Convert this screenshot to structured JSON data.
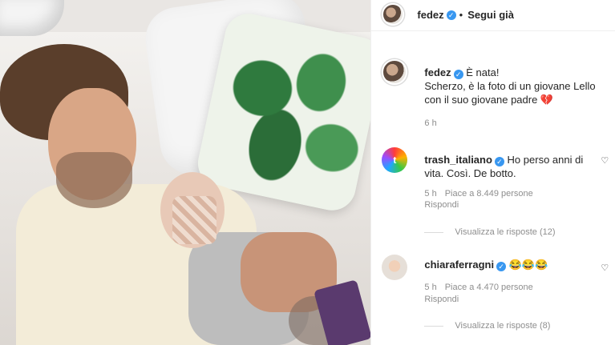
{
  "header": {
    "username": "fedez",
    "separator": "•",
    "follow_label": "Segui già"
  },
  "caption": {
    "username": "fedez",
    "text_line1": "È nata!",
    "text_line2": "Scherzo, è la foto di un giovane Lello",
    "text_line3": "con il suo giovane padre 💔",
    "time": "6 h"
  },
  "comments": [
    {
      "username": "trash_italiano",
      "avatar_letter": "t",
      "text_line1": "Ho perso anni di",
      "text_line2": "vita. Così. De botto.",
      "time": "5 h",
      "likes": "Piace a 8.449 persone",
      "reply_label": "Rispondi",
      "view_replies": "Visualizza le risposte (12)"
    },
    {
      "username": "chiaraferragni",
      "text_line1": "😂😂😂",
      "time": "5 h",
      "likes": "Piace a 4.470 persone",
      "reply_label": "Rispondi",
      "view_replies": "Visualizza le risposte (8)"
    }
  ],
  "icons": {
    "verified": "verified-badge-icon",
    "heart": "heart-icon"
  },
  "colors": {
    "verified_blue": "#3897f0",
    "meta_gray": "#8e8e8e"
  }
}
